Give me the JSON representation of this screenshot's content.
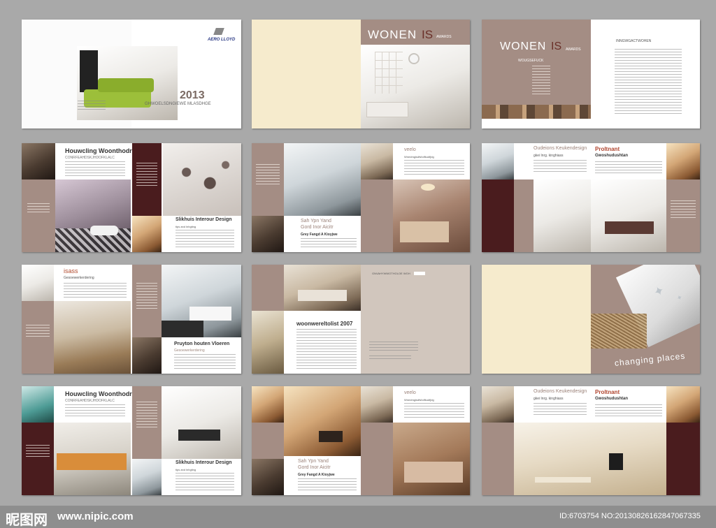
{
  "brand": {
    "logo_text": "AERO LLOYD",
    "year": "2013",
    "subtitle": "GHWOELSDNGIEWE MLASDHGE"
  },
  "awards": {
    "title_wonen": "WONEN",
    "title_is": "IS",
    "title_awards": "AWARDS",
    "sub": "WOUGSEFUCK",
    "heading_right": "INNGWGACTWOHEN"
  },
  "articles": {
    "houwcling": {
      "title": "Houwcling Woonthodr",
      "sub": "CONRFEAHDSKJHDOFKLALC"
    },
    "slikhuis": {
      "title": "Slikhuis Interour Design",
      "sub": "tips and lnhgting"
    },
    "sah": {
      "title": "Sah Ypn Yand",
      "title2": "Gord Inor Aicitr",
      "sub": "Grey Fangd A Kioyjwe"
    },
    "veelo": {
      "title": "veelo",
      "sub": "Wnedmgisdfshdfkudfjdg"
    },
    "oudeions": {
      "title": "Oudeions Keukendesign",
      "sub": "gkei lnrg. kinghiass"
    },
    "proltnant": {
      "title": "Proltnant",
      "sub": "Gwoshudushtan"
    },
    "isass": {
      "title": "isass",
      "sub": "Gesoewerkerdering"
    },
    "pruyton": {
      "title": "Pruyton houten Vloeren",
      "sub": "Gesoewerkerdering"
    },
    "woonwereld": {
      "title": "woonwereltolist 2007"
    },
    "grid_title": "GNVAHYWWOTHOLOE WGH",
    "changing": "changing places"
  },
  "footer": {
    "logo": "昵图网",
    "url": "www.nipic.com",
    "id_text": "ID:6703754 NO:20130826162847067335"
  },
  "colors": {
    "taupe": "#a48d84",
    "wine": "#4a1c1e",
    "cream": "#f6ebcd",
    "background": "#a9a9a9"
  }
}
